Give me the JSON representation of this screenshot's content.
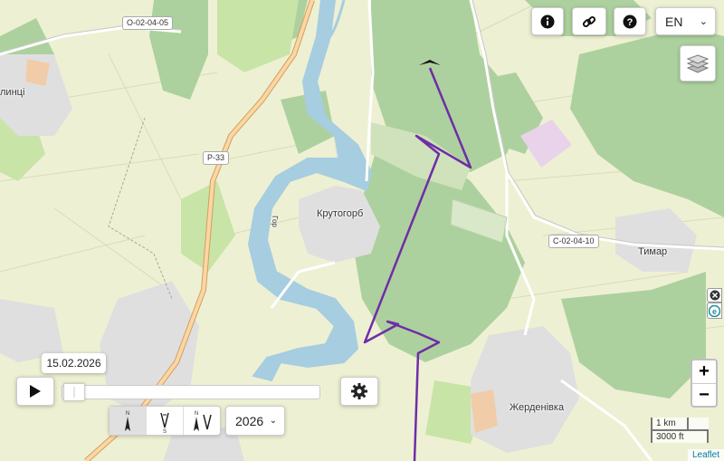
{
  "map": {
    "places": {
      "krutohorb": "Крутогорб",
      "tymar": "Тимар",
      "zherdenivka": "Жерденівка",
      "edge_town": "линці"
    },
    "roads": {
      "o020405": "О-02-04-05",
      "p33": "Р-33",
      "c020410": "С-02-04-10"
    },
    "river_label": "Гор",
    "route_color": "#6f2da8"
  },
  "top_controls": {
    "info_icon": "info-icon",
    "link_icon": "link-icon",
    "help_icon": "help-icon",
    "language": "EN"
  },
  "layers_icon": "layers-icon",
  "zoom": {
    "in": "+",
    "out": "−"
  },
  "scale": {
    "metric": "1 km",
    "imperial": "3000 ft"
  },
  "attribution": "Leaflet",
  "timeline": {
    "date": "15.02.2026",
    "year": "2026",
    "progress": 0.05,
    "orientation_buttons": [
      "N",
      "S",
      "N"
    ]
  }
}
